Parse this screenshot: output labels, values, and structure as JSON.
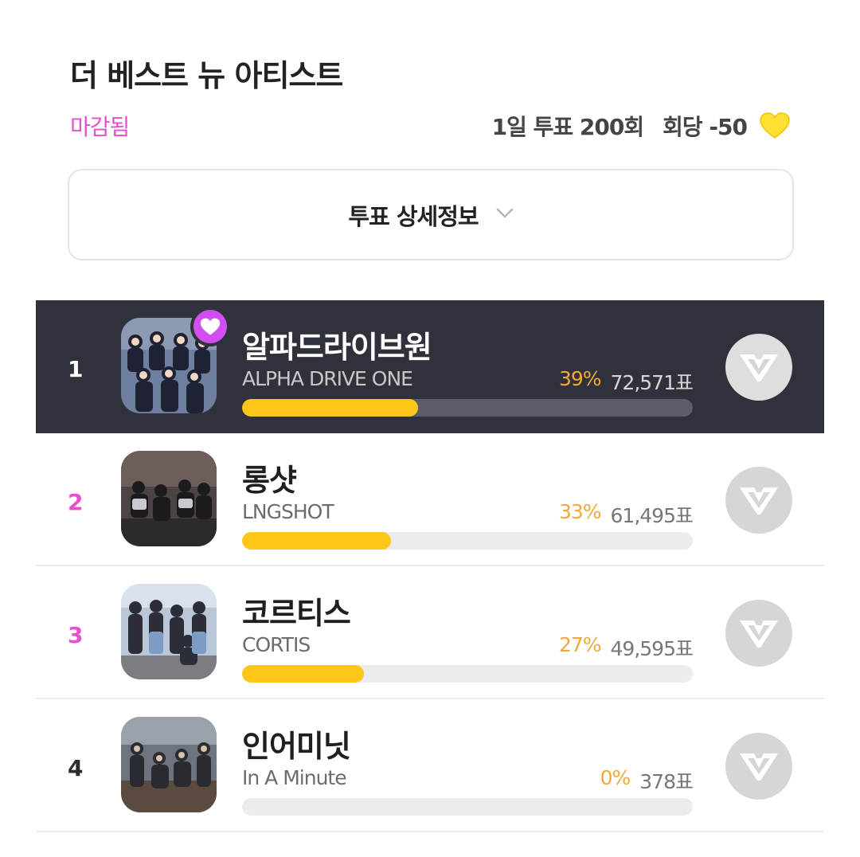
{
  "header": {
    "title": "더 베스트 뉴 아티스트",
    "status": "마감됨",
    "vote_rule": "1일 투표 200회",
    "per_vote": "회당 -50",
    "per_vote_icon": "yellow-heart-icon"
  },
  "detail_toggle": {
    "label": "투표 상세정보",
    "icon": "chevron-down-icon"
  },
  "colors": {
    "accent_pink": "#e64fce",
    "bar_yellow": "#ffc61a",
    "percent_orange": "#f2a93b",
    "highlight_row": "#2f323a"
  },
  "ranking": [
    {
      "rank": "1",
      "name_ko": "알파드라이브원",
      "name_en": "ALPHA DRIVE ONE",
      "percent": "39%",
      "votes": "72,571표",
      "share": 0.39,
      "favorite": true
    },
    {
      "rank": "2",
      "name_ko": "롱샷",
      "name_en": "LNGSHOT",
      "percent": "33%",
      "votes": "61,495표",
      "share": 0.33,
      "favorite": false
    },
    {
      "rank": "3",
      "name_ko": "코르티스",
      "name_en": "CORTIS",
      "percent": "27%",
      "votes": "49,595표",
      "share": 0.27,
      "favorite": false
    },
    {
      "rank": "4",
      "name_ko": "인어미닛",
      "name_en": "In A Minute",
      "percent": "0%",
      "votes": "378표",
      "share": 0.0,
      "favorite": false
    }
  ]
}
